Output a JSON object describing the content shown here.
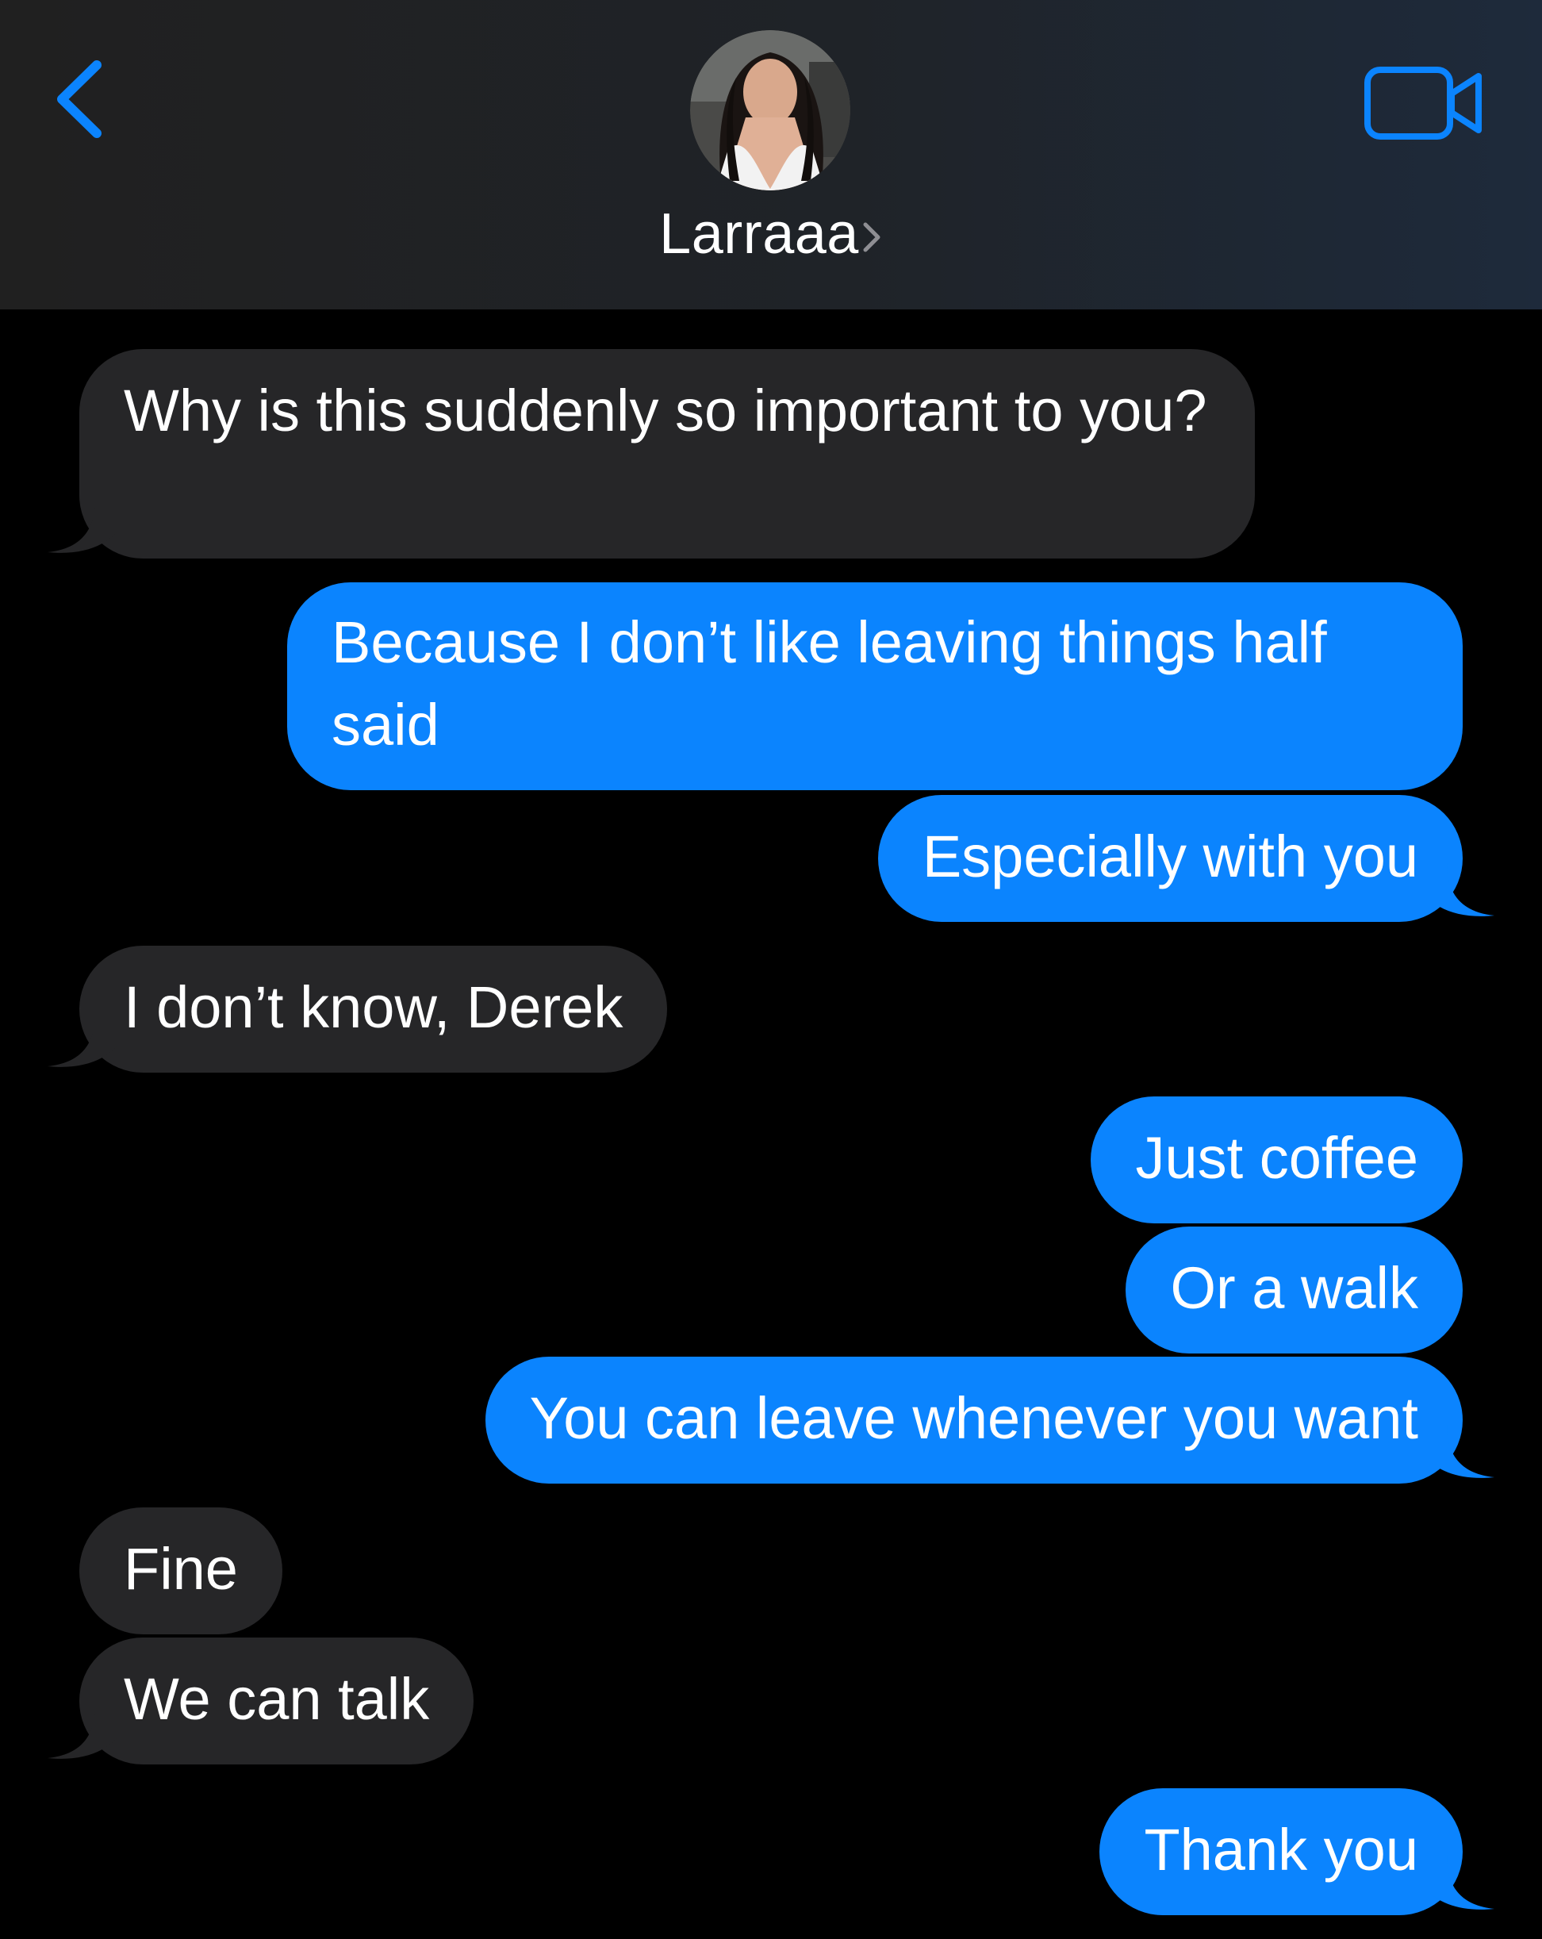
{
  "header": {
    "contact_name": "Larraaa",
    "accent_color": "#0b84fe",
    "back_icon": "chevron-left-icon",
    "video_icon": "video-camera-icon",
    "disclosure_icon": "chevron-right-icon"
  },
  "messages": [
    {
      "direction": "received",
      "text": "Why is this suddenly so important to you?"
    },
    {
      "direction": "sent",
      "text": "Because I don’t like leaving things half said"
    },
    {
      "direction": "sent",
      "text": "Especially with you"
    },
    {
      "direction": "received",
      "text": "I don’t know, Derek"
    },
    {
      "direction": "sent",
      "text": "Just coffee"
    },
    {
      "direction": "sent",
      "text": "Or a walk"
    },
    {
      "direction": "sent",
      "text": "You can leave whenever you want"
    },
    {
      "direction": "received",
      "text": "Fine"
    },
    {
      "direction": "received",
      "text": "We can talk"
    },
    {
      "direction": "sent",
      "text": "Thank you"
    }
  ],
  "colors": {
    "sent_bubble": "#0b84fe",
    "received_bubble": "#262628",
    "background": "#000000"
  }
}
